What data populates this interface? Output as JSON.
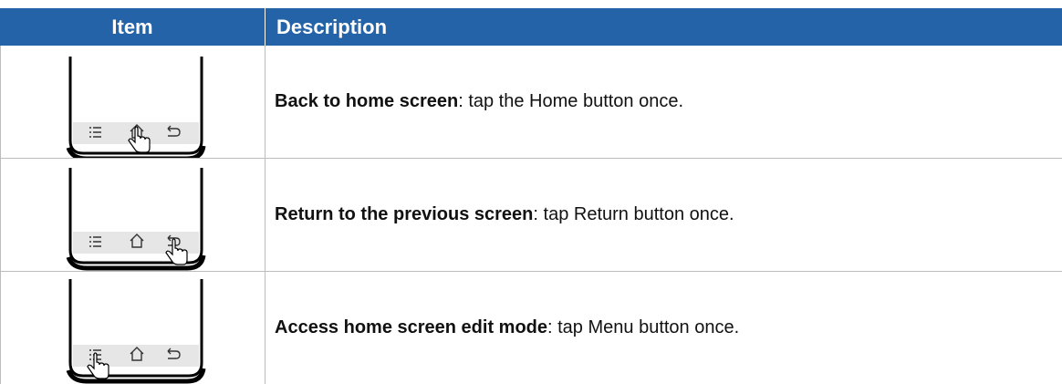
{
  "table": {
    "headers": {
      "item": "Item",
      "description": "Description"
    },
    "rows": [
      {
        "bold": "Back to home screen",
        "rest": ": tap the Home button once.",
        "tapped": "home-icon"
      },
      {
        "bold": "Return to the previous screen",
        "rest": ": tap Return button once.",
        "tapped": "return-icon"
      },
      {
        "bold": "Access home screen edit mode",
        "rest": ": tap Menu button once.",
        "tapped": "menu-icon"
      }
    ]
  },
  "colors": {
    "header_bg": "#2563a8",
    "header_text": "#ffffff",
    "bar_bg": "#e6e6e6"
  }
}
